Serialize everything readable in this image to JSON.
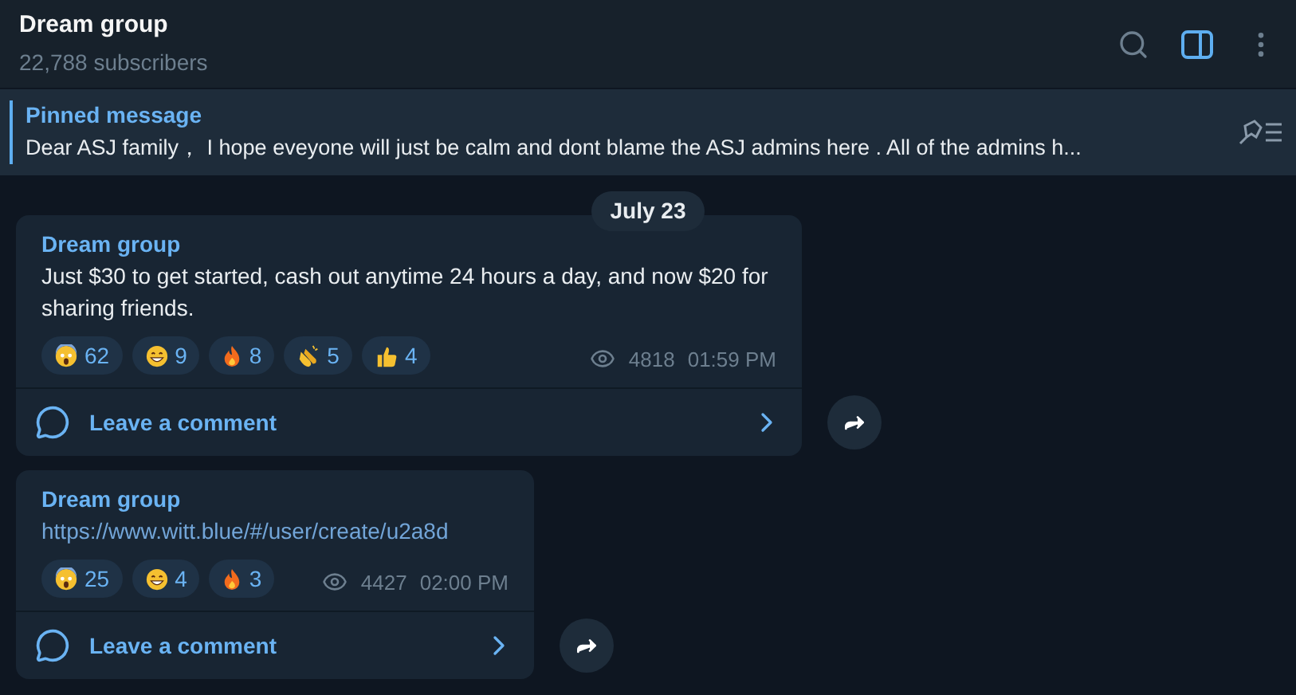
{
  "header": {
    "title": "Dream group",
    "subtitle": "22,788 subscribers",
    "sidebar_toggle_on": true
  },
  "pinned": {
    "label": "Pinned message",
    "text": "Dear ASJ family，  I hope eveyone will just be calm and dont blame the ASJ admins here . All of the admins h..."
  },
  "date_badge": "July 23",
  "messages": [
    {
      "author": "Dream group",
      "kind": "text",
      "text": "Just $30 to get started, cash out anytime 24 hours a day, and now $20 for sharing friends.",
      "reactions": [
        {
          "kind": "scream",
          "count": "62"
        },
        {
          "kind": "grin",
          "count": "9"
        },
        {
          "kind": "fire",
          "count": "8"
        },
        {
          "kind": "clap",
          "count": "5"
        },
        {
          "kind": "thumbs",
          "count": "4"
        }
      ],
      "views": "4818",
      "time": "01:59 PM",
      "comment": "Leave a comment"
    },
    {
      "author": "Dream group",
      "kind": "link",
      "text": "https://www.witt.blue/#/user/create/u2a8d",
      "reactions": [
        {
          "kind": "scream",
          "count": "25"
        },
        {
          "kind": "grin",
          "count": "4"
        },
        {
          "kind": "fire",
          "count": "3"
        }
      ],
      "views": "4427",
      "time": "02:00 PM",
      "comment": "Leave a comment"
    }
  ]
}
